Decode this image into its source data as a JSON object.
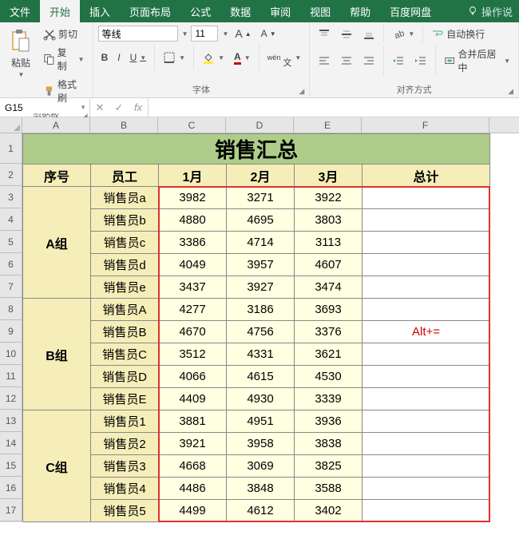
{
  "tabs": {
    "file": "文件",
    "home": "开始",
    "insert": "插入",
    "layout": "页面布局",
    "formula": "公式",
    "data": "数据",
    "review": "审阅",
    "view": "视图",
    "help": "帮助",
    "baidu": "百度网盘",
    "tell": "操作说"
  },
  "ribbon": {
    "clipboard": {
      "paste": "粘贴",
      "cut": "剪切",
      "copy": "复制",
      "painter": "格式刷",
      "label": "剪贴板"
    },
    "font": {
      "name": "等线",
      "size": "11",
      "label": "字体",
      "bold": "B",
      "italic": "I",
      "underline": "U"
    },
    "align": {
      "wrap": "自动换行",
      "merge": "合并后居中",
      "label": "对齐方式"
    }
  },
  "namebox": "G15",
  "colHeaders": [
    "A",
    "B",
    "C",
    "D",
    "E",
    "F"
  ],
  "rowHeaders": [
    "1",
    "2",
    "3",
    "4",
    "5",
    "6",
    "7",
    "8",
    "9",
    "10",
    "11",
    "12",
    "13",
    "14",
    "15",
    "16",
    "17"
  ],
  "sheet": {
    "title": "销售汇总",
    "headers": {
      "seq": "序号",
      "emp": "员工",
      "m1": "1月",
      "m2": "2月",
      "m3": "3月",
      "total": "总计"
    },
    "annotation": "Alt+=",
    "groups": [
      {
        "name": "A组",
        "rows": [
          {
            "emp": "销售员a",
            "v": [
              3982,
              3271,
              3922
            ]
          },
          {
            "emp": "销售员b",
            "v": [
              4880,
              4695,
              3803
            ]
          },
          {
            "emp": "销售员c",
            "v": [
              3386,
              4714,
              3113
            ]
          },
          {
            "emp": "销售员d",
            "v": [
              4049,
              3957,
              4607
            ]
          },
          {
            "emp": "销售员e",
            "v": [
              3437,
              3927,
              3474
            ]
          }
        ]
      },
      {
        "name": "B组",
        "rows": [
          {
            "emp": "销售员A",
            "v": [
              4277,
              3186,
              3693
            ]
          },
          {
            "emp": "销售员B",
            "v": [
              4670,
              4756,
              3376
            ]
          },
          {
            "emp": "销售员C",
            "v": [
              3512,
              4331,
              3621
            ]
          },
          {
            "emp": "销售员D",
            "v": [
              4066,
              4615,
              4530
            ]
          },
          {
            "emp": "销售员E",
            "v": [
              4409,
              4930,
              3339
            ]
          }
        ]
      },
      {
        "name": "C组",
        "rows": [
          {
            "emp": "销售员1",
            "v": [
              3881,
              4951,
              3936
            ]
          },
          {
            "emp": "销售员2",
            "v": [
              3921,
              3958,
              3838
            ]
          },
          {
            "emp": "销售员3",
            "v": [
              4668,
              3069,
              3825
            ]
          },
          {
            "emp": "销售员4",
            "v": [
              4486,
              3848,
              3588
            ]
          },
          {
            "emp": "销售员5",
            "v": [
              4499,
              4612,
              3402
            ]
          }
        ]
      }
    ]
  }
}
